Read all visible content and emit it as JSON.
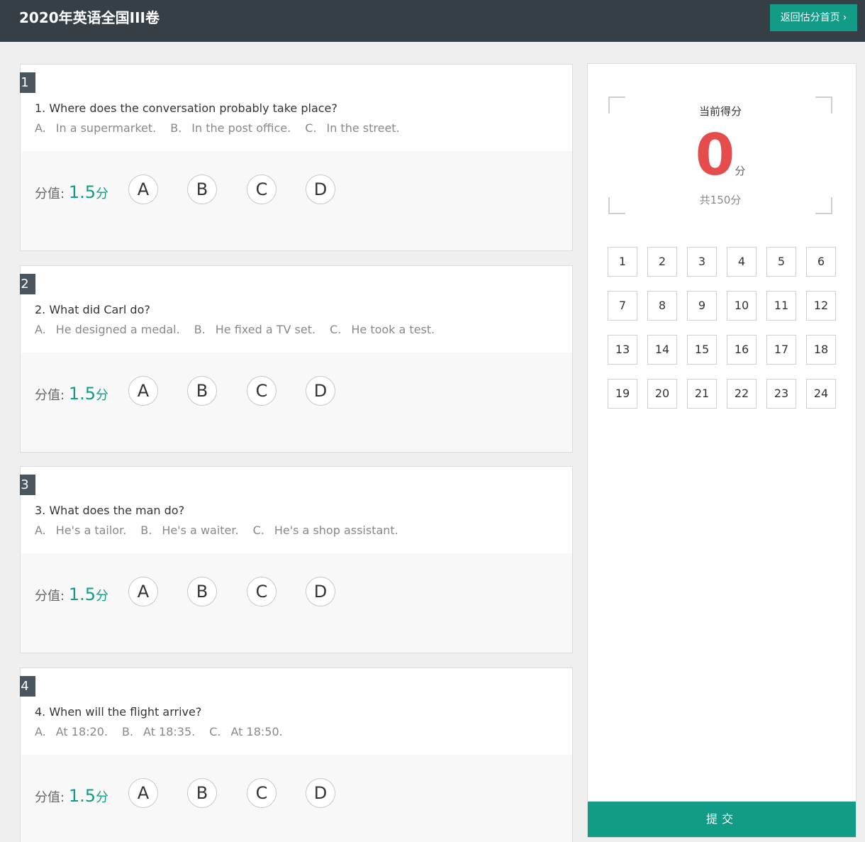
{
  "header": {
    "title": "2020年英语全国III卷",
    "back_label": "返回估分首页",
    "back_icon": "chevron-right-icon"
  },
  "questions": [
    {
      "num": "1",
      "text": "1. Where does the conversation probably take place?",
      "options": [
        {
          "letter": "A.",
          "text": "In a supermarket."
        },
        {
          "letter": "B.",
          "text": "In the post office."
        },
        {
          "letter": "C.",
          "text": "In the street."
        }
      ],
      "score_label": "分值:",
      "score_value": "1.5",
      "score_unit": "分",
      "choices": [
        "A",
        "B",
        "C",
        "D"
      ]
    },
    {
      "num": "2",
      "text": "2. What did Carl do?",
      "options": [
        {
          "letter": "A.",
          "text": "He designed a medal."
        },
        {
          "letter": "B.",
          "text": "He fixed a TV set."
        },
        {
          "letter": "C.",
          "text": "He took a test."
        }
      ],
      "score_label": "分值:",
      "score_value": "1.5",
      "score_unit": "分",
      "choices": [
        "A",
        "B",
        "C",
        "D"
      ]
    },
    {
      "num": "3",
      "text": "3. What does the man do?",
      "options": [
        {
          "letter": "A.",
          "text": "He's a tailor."
        },
        {
          "letter": "B.",
          "text": "He's a waiter."
        },
        {
          "letter": "C.",
          "text": "He's a shop assistant."
        }
      ],
      "score_label": "分值:",
      "score_value": "1.5",
      "score_unit": "分",
      "choices": [
        "A",
        "B",
        "C",
        "D"
      ]
    },
    {
      "num": "4",
      "text": "4. When will the flight arrive?",
      "options": [
        {
          "letter": "A.",
          "text": "At 18:20."
        },
        {
          "letter": "B.",
          "text": "At 18:35."
        },
        {
          "letter": "C.",
          "text": "At 18:50."
        }
      ],
      "score_label": "分值:",
      "score_value": "1.5",
      "score_unit": "分",
      "choices": [
        "A",
        "B",
        "C",
        "D"
      ]
    }
  ],
  "panel": {
    "current_label": "当前得分",
    "current_score": "0",
    "score_unit": "分",
    "total": "共150分",
    "question_numbers": [
      "1",
      "2",
      "3",
      "4",
      "5",
      "6",
      "7",
      "8",
      "9",
      "10",
      "11",
      "12",
      "13",
      "14",
      "15",
      "16",
      "17",
      "18",
      "19",
      "20",
      "21",
      "22",
      "23",
      "24"
    ],
    "submit_label": "提交"
  },
  "colors": {
    "accent": "#129b86",
    "header_bg": "#363f45",
    "score_red": "#e54c4c",
    "qnum_bg": "#4a555d"
  }
}
